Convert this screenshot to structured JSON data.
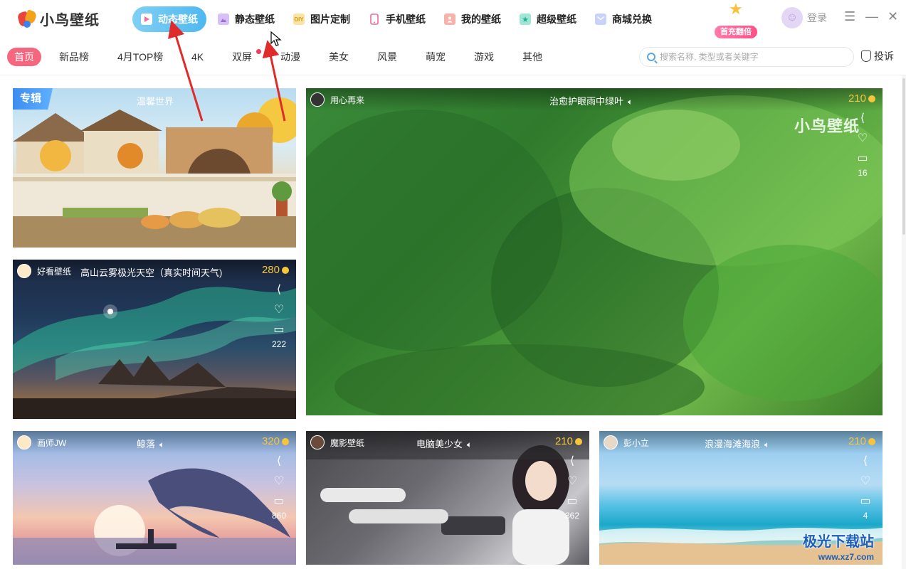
{
  "app": {
    "name": "小鸟壁纸"
  },
  "mainnav": [
    {
      "label": "动态壁纸",
      "icon": "video-icon",
      "color": "#ffffff"
    },
    {
      "label": "静态壁纸",
      "icon": "image-icon",
      "color": "#c9a6f0"
    },
    {
      "label": "图片定制",
      "icon": "diy-icon",
      "color": "#f7d36a",
      "badge": "DIY"
    },
    {
      "label": "手机壁纸",
      "icon": "phone-icon",
      "color": "#f38db4"
    },
    {
      "label": "我的壁纸",
      "icon": "user-icon",
      "color": "#f59a8d"
    },
    {
      "label": "超级壁纸",
      "icon": "star-icon",
      "color": "#5fd0b8"
    },
    {
      "label": "商城兑换",
      "icon": "mail-icon",
      "color": "#a9b8f5"
    }
  ],
  "promo": {
    "label": "首充翻倍"
  },
  "login": {
    "label": "登录"
  },
  "window": {
    "menu": "☰",
    "minimize": "—",
    "close": "✕"
  },
  "categories": [
    "首页",
    "新品榜",
    "4月TOP榜",
    "4K",
    "双屏",
    "动漫",
    "美女",
    "风景",
    "萌宠",
    "游戏",
    "其他"
  ],
  "search": {
    "placeholder": "搜索名称, 类型或者关键字"
  },
  "report": {
    "label": "投诉"
  },
  "cards": {
    "album": {
      "tag": "专辑",
      "title": "温馨世界"
    },
    "aurora": {
      "author": "好看壁纸",
      "title": "高山云雾极光天空（真实时间天气)",
      "price": "280",
      "comments": "222"
    },
    "forest": {
      "author": "用心再来",
      "title": "治愈护眼雨中绿叶",
      "price": "210",
      "comments": "16",
      "watermark": "小鸟壁纸"
    },
    "whale": {
      "author": "画师JW",
      "title": "鲸落",
      "price": "320",
      "comments": "860"
    },
    "girl": {
      "author": "魔影壁纸",
      "title": "电脑美少女",
      "price": "210",
      "comments": "362"
    },
    "beach": {
      "author": "彭小立",
      "title": "浪漫海滩海浪",
      "price": "210",
      "comments": "4"
    }
  },
  "site_watermark": {
    "name": "极光下载站",
    "url": "www.xz7.com"
  },
  "colors": {
    "accent": "#4eb8f0",
    "category_active": "#f6667f",
    "price": "#f7c43a",
    "album_tag": "#3d8df0",
    "annotation_arrow": "#e02b2b"
  }
}
